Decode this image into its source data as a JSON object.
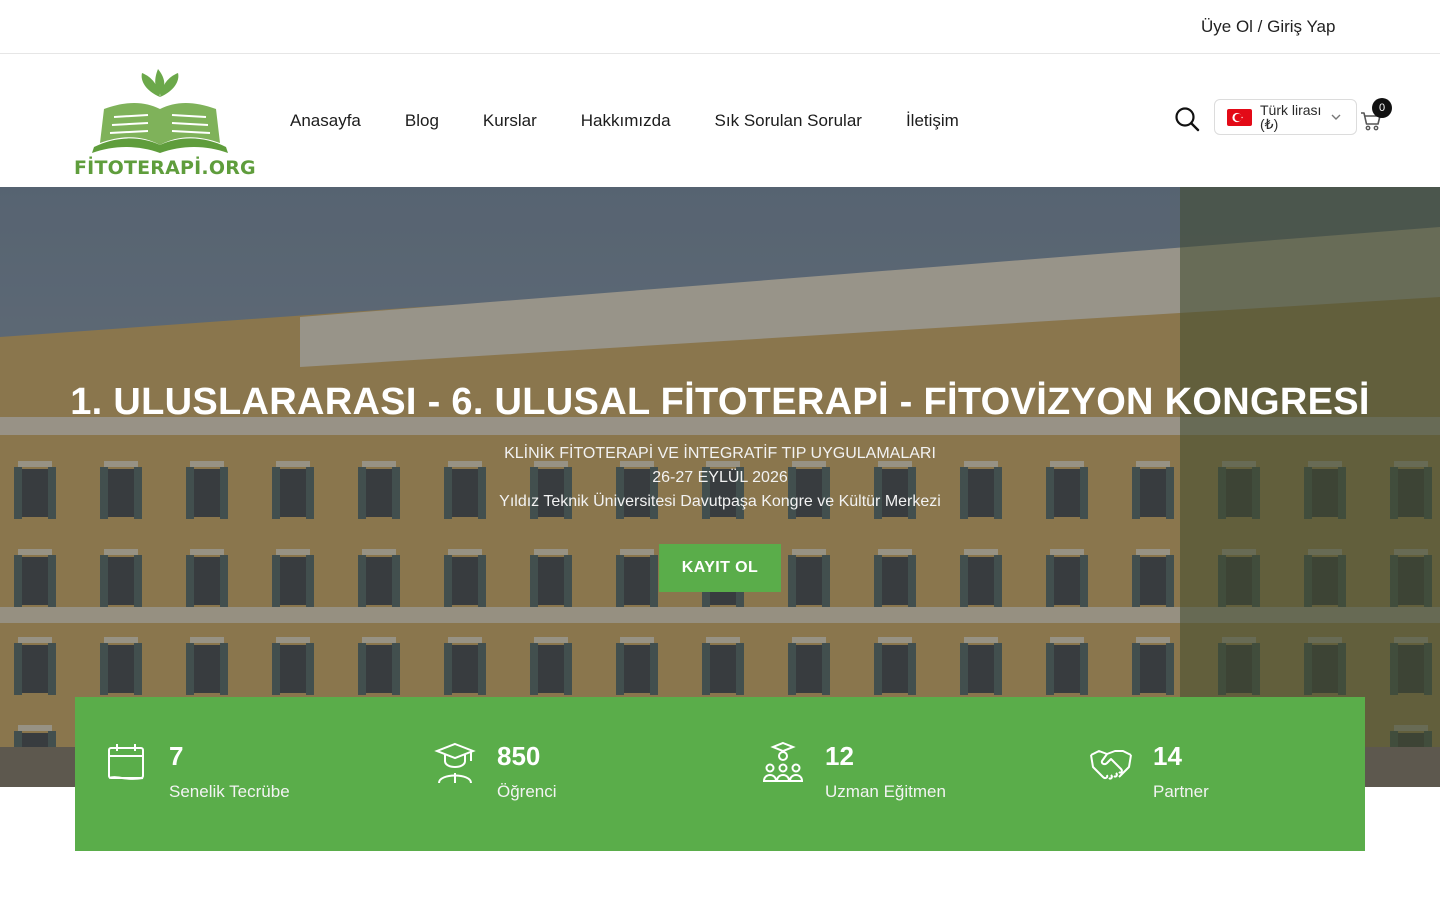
{
  "topbar": {
    "auth": "Üye Ol / Giriş Yap"
  },
  "header": {
    "logo_text": "FİTOTERAPİ.ORG",
    "nav": [
      "Anasayfa",
      "Blog",
      "Kurslar",
      "Hakkımızda",
      "Sık Sorulan Sorular",
      "İletişim"
    ],
    "currency": "Türk lirası (₺)",
    "cart_count": "0",
    "icons": {
      "search": "search-icon",
      "cart": "cart-icon",
      "flag": "turkey-flag-icon",
      "dropdown": "chevron-down-icon"
    }
  },
  "hero": {
    "title": "1. ULUSLARARASI - 6. ULUSAL FİTOTERAPİ - FİTOVİZYON KONGRESİ",
    "lines": [
      "KLİNİK FİTOTERAPİ VE İNTEGRATİF TIP UYGULAMALARI",
      "26-27 EYLÜL 2026",
      "Yıldız Teknik Üniversitesi Davutpaşa Kongre ve Kültür Merkezi"
    ],
    "cta": "KAYIT OL"
  },
  "stats": [
    {
      "value": "7",
      "label": "Senelik Tecrübe",
      "icon": "calendar-icon"
    },
    {
      "value": "850",
      "label": "Öğrenci",
      "icon": "graduate-icon"
    },
    {
      "value": "12",
      "label": "Uzman Eğitmen",
      "icon": "instructors-icon"
    },
    {
      "value": "14",
      "label": "Partner",
      "icon": "handshake-icon"
    }
  ],
  "colors": {
    "brand_green": "#5aad4a",
    "logo_green": "#5f9d3c",
    "text": "#1f1f1f"
  }
}
